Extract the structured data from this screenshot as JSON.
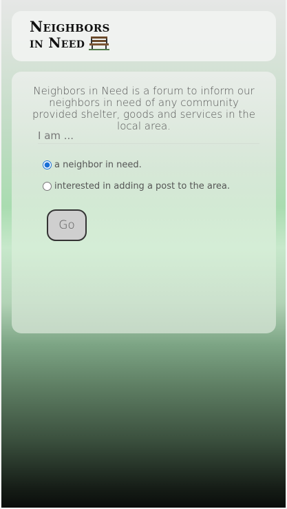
{
  "header": {
    "logo_line1": "Neighbors",
    "logo_line2": "in Need",
    "logo_icon": "bench-icon"
  },
  "main": {
    "intro": "Neighbors in Need is a forum to inform our neighbors in need of any community provided shelter, goods and services in the local area.",
    "role_label": "I am ...",
    "options": [
      {
        "label": "a neighbor in need.",
        "checked": true
      },
      {
        "label": "interested in adding a post to the area.",
        "checked": false
      }
    ],
    "go_label": "Go"
  },
  "colors": {
    "radio_accent": "#1a6fd6",
    "logo_text": "#111111"
  }
}
